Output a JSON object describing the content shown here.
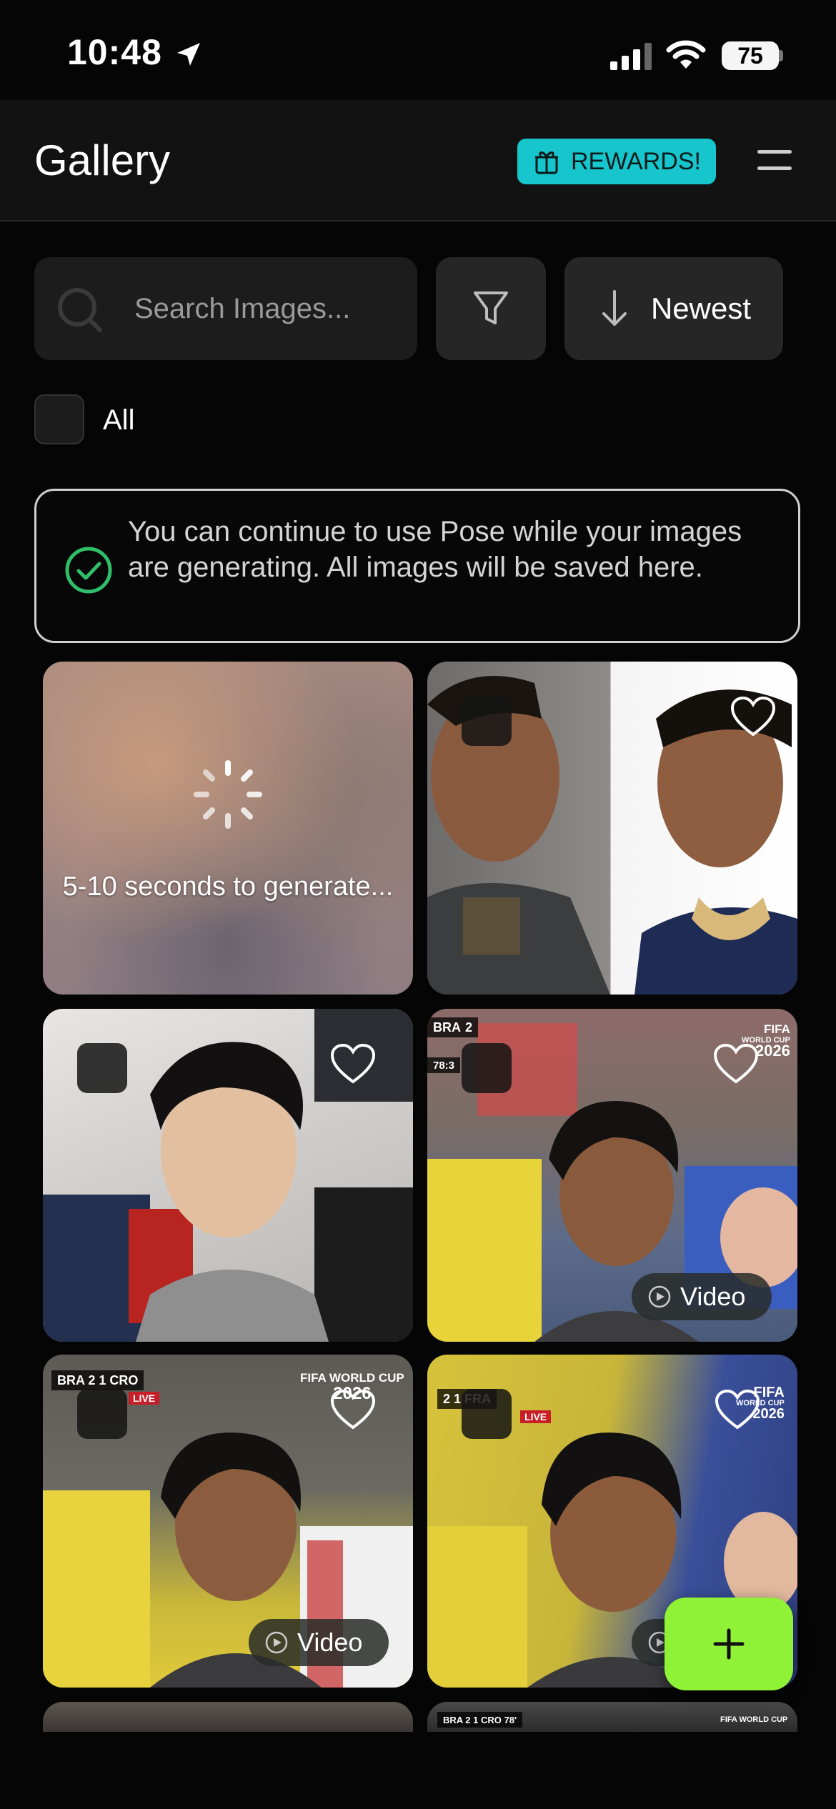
{
  "status_bar": {
    "time": "10:48",
    "battery": "75"
  },
  "header": {
    "title": "Gallery",
    "rewards_label": "REWARDS!"
  },
  "toolbar": {
    "search_placeholder": "Search Images...",
    "sort_label": "Newest",
    "select_all_label": "All"
  },
  "notice": {
    "text": "You can continue to use Pose while your images are generating. All images will be saved here."
  },
  "gallery": {
    "generating_text": "5-10 seconds to generate...",
    "video_label": "Video",
    "overlays": {
      "tile4_score_team1": "BRA",
      "tile4_score_val1": "2",
      "tile4_time": "78:3",
      "tile4_wc_line1": "FIFA",
      "tile4_wc_line2": "WORLD CUP",
      "tile4_wc_line3": "2026",
      "tile5_score": "BRA 2 1 CRO",
      "tile5_live": "LIVE",
      "tile5_wc_line1": "FIFA WORLD CUP",
      "tile5_wc_line2": "2026",
      "tile6_score": "2 1 FRA",
      "tile6_live": "LIVE",
      "tile6_wc_line1": "FIFA",
      "tile6_wc_line2": "WORLD CUP",
      "tile6_wc_line3": "2026",
      "row4_score": "BRA 2 1 CRO 78'",
      "row4_wc": "FIFA WORLD CUP"
    }
  },
  "colors": {
    "rewards_bg": "#16c6cc",
    "fab_bg": "#8ff236",
    "check_green": "#2fbf6a"
  }
}
